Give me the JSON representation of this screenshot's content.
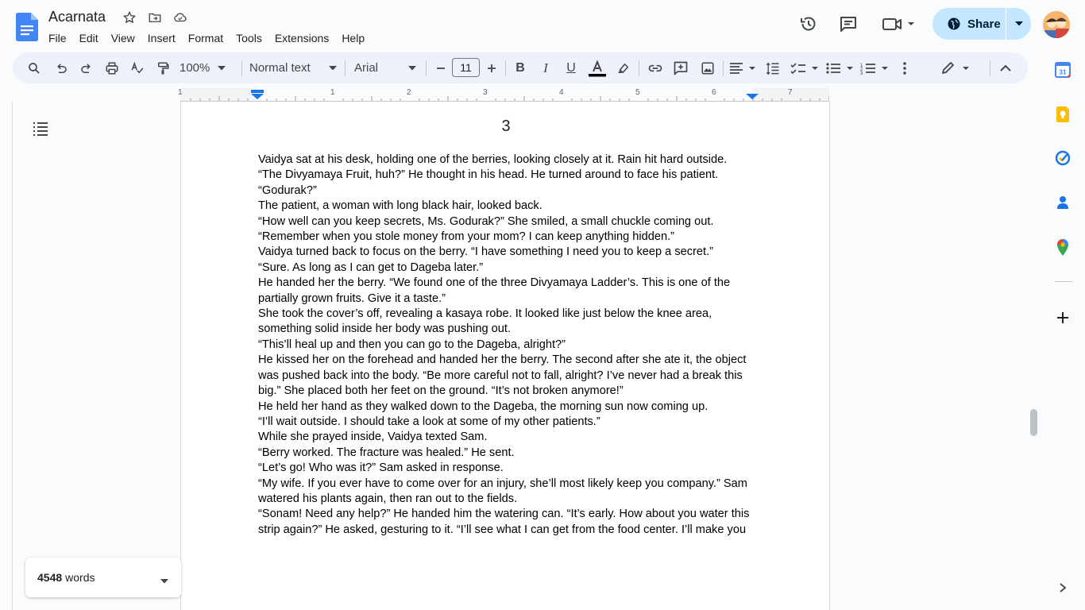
{
  "document": {
    "title": "Acarnata",
    "page_number": "3",
    "paragraphs": [
      "Vaidya sat at his desk, holding one of the berries, looking closely at it. Rain hit hard outside.",
      "“The Divyamaya Fruit, huh?” He thought in his head. He turned around to face his patient. “Godurak?”",
      "The patient, a woman with long black hair, looked back.",
      "“How well can you keep secrets, Ms. Godurak?” She smiled, a small chuckle coming out.",
      "“Remember when you stole money from your mom? I can keep anything hidden.”",
      "Vaidya turned back to focus on the berry. “I have something I need you to keep a secret.”",
      "“Sure. As long as I can get to Dageba later.”",
      "He handed her the berry. “We found one of the three Divyamaya Ladder’s. This is one of the partially grown fruits. Give it a taste.”",
      "She took the cover’s off, revealing a kasaya robe. It looked like just below the knee area, something solid inside her body was pushing out.",
      "“This’ll heal up and then you can go to the Dageba, alright?”",
      "He kissed her on the forehead and handed her the berry. The second after she ate it, the object was pushed back into the body. “Be more careful not to fall, alright? I’ve never had a break this big.” She placed both her feet on the ground. “It’s not broken anymore!”",
      "He held her hand as they walked down to the Dageba, the morning sun now coming up.",
      "“I’ll wait outside. I should take a look at some of my other patients.”",
      "While she prayed inside, Vaidya texted Sam.",
      "“Berry worked. The fracture was healed.” He sent.",
      "“Let’s go! Who was it?” Sam asked in response.",
      "“My wife. If you ever have to come over for an injury, she’ll most likely keep you company.” Sam watered his plants again, then ran out to the fields.",
      "“Sonam! Need any help?” He handed him the watering can. “It’s early. How about you water this strip again?” He asked, gesturing to it. “I’ll see what I can get from the food center. I’ll make you"
    ]
  },
  "menu": [
    "File",
    "Edit",
    "View",
    "Insert",
    "Format",
    "Tools",
    "Extensions",
    "Help"
  ],
  "header": {
    "share_label": "Share"
  },
  "toolbar": {
    "zoom": "100%",
    "style": "Normal text",
    "font": "Arial",
    "font_size": "11"
  },
  "ruler": {
    "labels": [
      "1",
      "1",
      "2",
      "3",
      "4",
      "5",
      "6",
      "7"
    ]
  },
  "word_count": {
    "count": "4548",
    "label": "words"
  },
  "colors": {
    "accent": "#0b57d0",
    "share_bg": "#c2e7ff",
    "toolbar_bg": "#edf2fa",
    "app_bg": "#f9fbfd"
  },
  "icons": {
    "title": [
      "star-icon",
      "move-to-folder-icon",
      "cloud-saved-icon"
    ],
    "header": [
      "version-history-icon",
      "comments-icon",
      "meet-video-icon"
    ],
    "sidepanel": [
      "calendar-icon",
      "keep-icon",
      "tasks-icon",
      "contacts-icon",
      "maps-icon",
      "plus-icon",
      "chevron-right-icon"
    ]
  }
}
